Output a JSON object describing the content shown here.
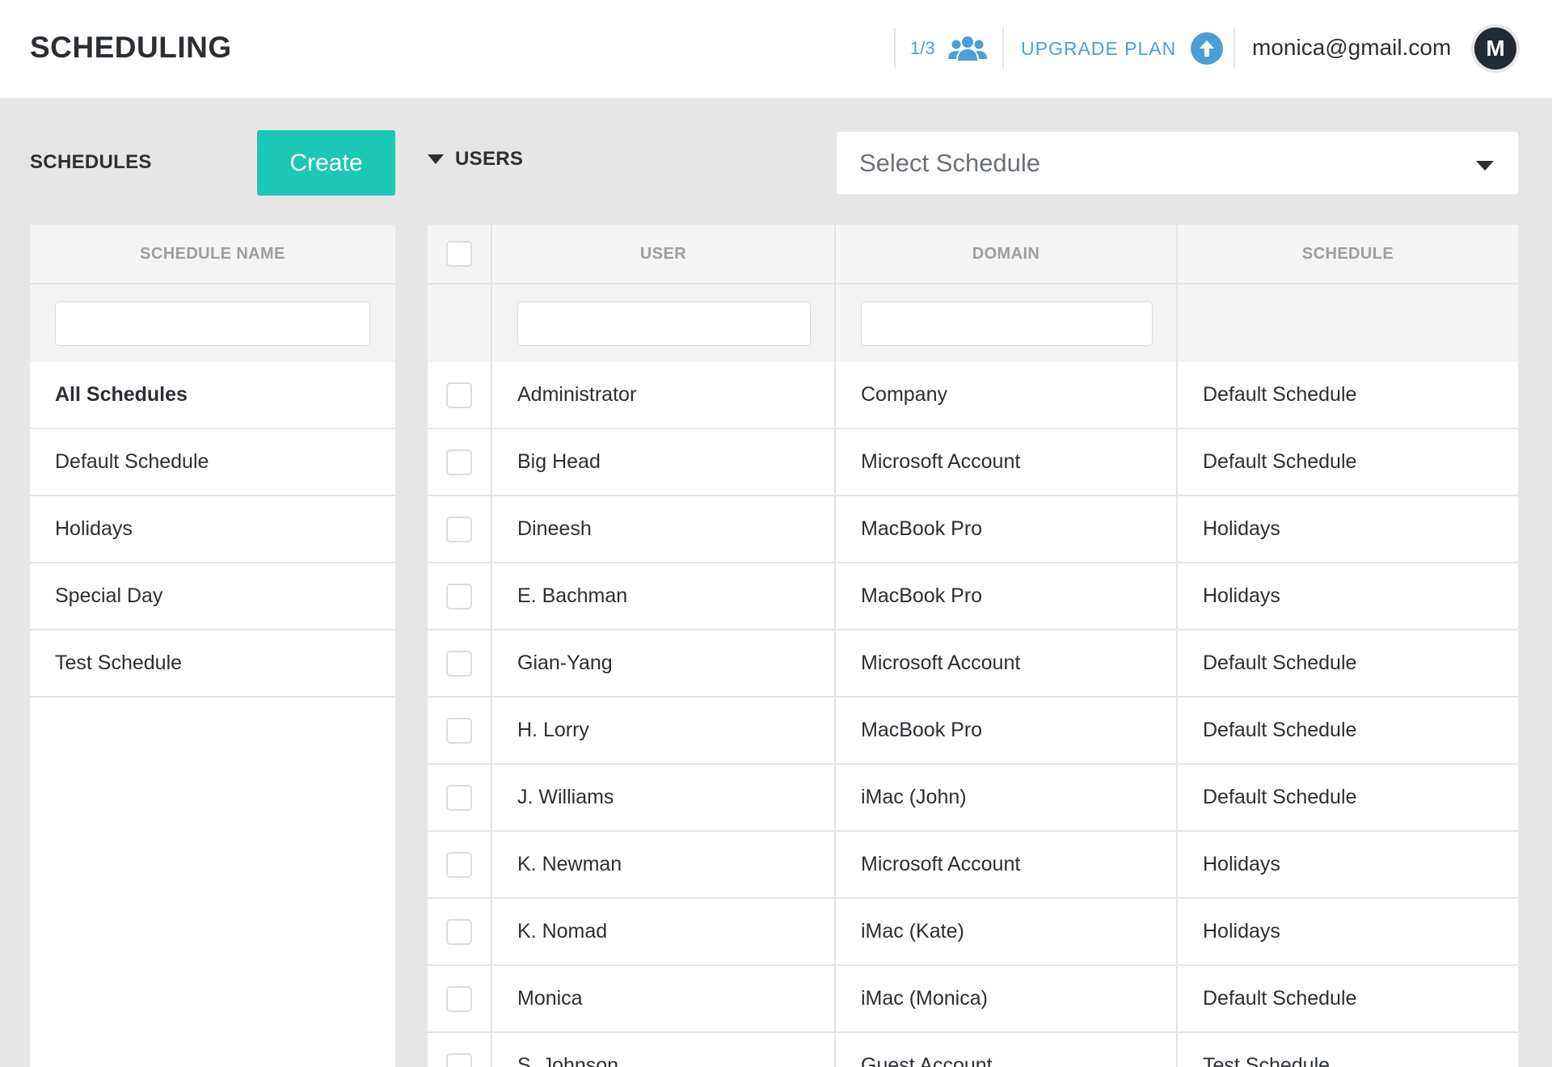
{
  "header": {
    "title": "SCHEDULING",
    "seats": "1/3",
    "seats_icon": "users-group-icon",
    "upgrade_label": "UPGRADE PLAN",
    "upgrade_icon": "arrow-up-circle-icon",
    "email": "monica@gmail.com",
    "avatar_initial": "M",
    "accent_color": "#4a9fd8"
  },
  "toolbar": {
    "schedules_title": "SCHEDULES",
    "create_label": "Create",
    "create_color": "#1cc8b5",
    "users_label": "USERS",
    "select_schedule_placeholder": "Select Schedule"
  },
  "schedules_panel": {
    "column_header": "SCHEDULE NAME",
    "items": [
      {
        "label": "All Schedules",
        "active": true
      },
      {
        "label": "Default Schedule",
        "active": false
      },
      {
        "label": "Holidays",
        "active": false
      },
      {
        "label": "Special Day",
        "active": false
      },
      {
        "label": "Test Schedule",
        "active": false
      }
    ]
  },
  "users_table": {
    "columns": [
      "USER",
      "DOMAIN",
      "SCHEDULE"
    ],
    "rows": [
      {
        "user": "Administrator",
        "domain": "Company",
        "schedule": "Default Schedule"
      },
      {
        "user": "Big Head",
        "domain": "Microsoft Account",
        "schedule": "Default Schedule"
      },
      {
        "user": "Dineesh",
        "domain": "MacBook Pro",
        "schedule": "Holidays"
      },
      {
        "user": "E. Bachman",
        "domain": "MacBook Pro",
        "schedule": "Holidays"
      },
      {
        "user": "Gian-Yang",
        "domain": "Microsoft Account",
        "schedule": "Default Schedule"
      },
      {
        "user": "H. Lorry",
        "domain": "MacBook Pro",
        "schedule": "Default Schedule"
      },
      {
        "user": "J. Williams",
        "domain": "iMac (John)",
        "schedule": "Default Schedule"
      },
      {
        "user": "K. Newman",
        "domain": "Microsoft Account",
        "schedule": "Holidays"
      },
      {
        "user": "K. Nomad",
        "domain": "iMac (Kate)",
        "schedule": "Holidays"
      },
      {
        "user": "Monica",
        "domain": "iMac (Monica)",
        "schedule": "Default Schedule"
      },
      {
        "user": "S. Johnson",
        "domain": "Guest Account",
        "schedule": "Test Schedule"
      }
    ]
  }
}
